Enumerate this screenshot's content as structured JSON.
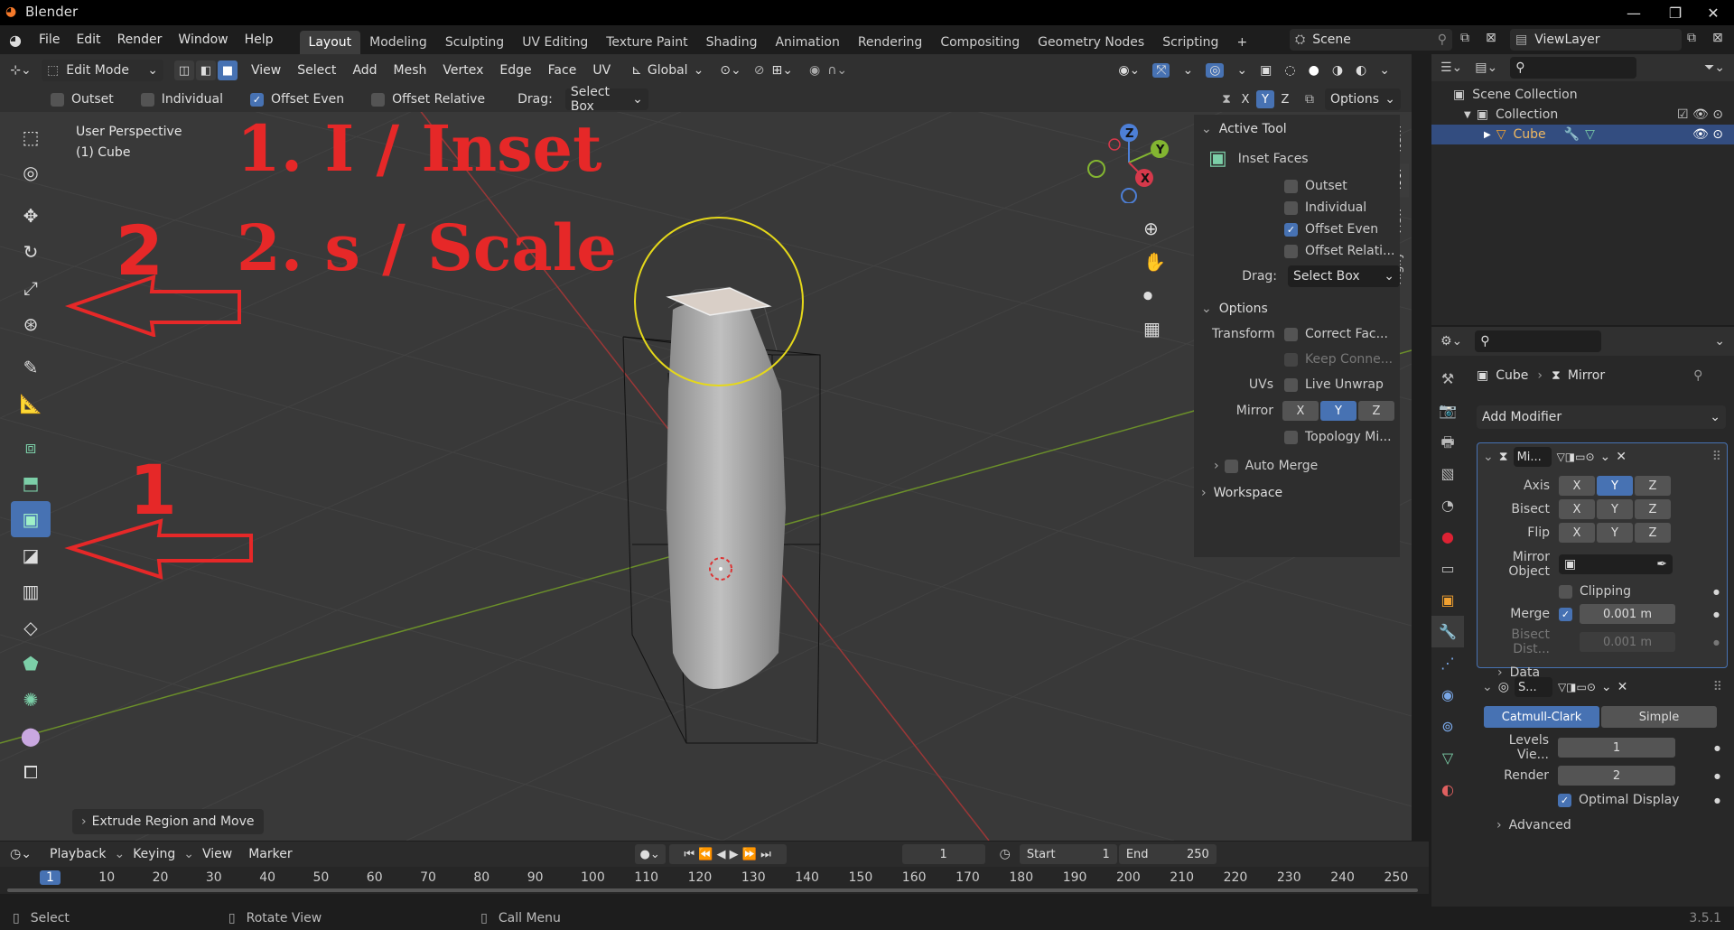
{
  "titlebar": {
    "title": "Blender",
    "min": "—",
    "max": "❐",
    "close": "✕"
  },
  "menubar": {
    "menus": [
      "File",
      "Edit",
      "Render",
      "Window",
      "Help"
    ],
    "tabs": [
      "Layout",
      "Modeling",
      "Sculpting",
      "UV Editing",
      "Texture Paint",
      "Shading",
      "Animation",
      "Rendering",
      "Compositing",
      "Geometry Nodes",
      "Scripting"
    ],
    "add_tab": "+",
    "scene": "Scene",
    "view_layer": "ViewLayer"
  },
  "viewport_header": {
    "mode": "Edit Mode",
    "menus": [
      "View",
      "Select",
      "Add",
      "Mesh",
      "Vertex",
      "Edge",
      "Face",
      "UV"
    ],
    "orientation": "Global",
    "axes": [
      "X",
      "Y",
      "Z"
    ],
    "options": "Options"
  },
  "tool_settings": {
    "outset": "Outset",
    "individual": "Individual",
    "offset_even": "Offset Even",
    "offset_relative": "Offset Relative",
    "drag_label": "Drag:",
    "drag_value": "Select Box"
  },
  "viewport": {
    "perspective": "User Perspective",
    "object": "(1) Cube",
    "annotation_line1": "1. I / Inset",
    "annotation_line2": "2. s / Scale",
    "annotation_num2": "2",
    "annotation_num1": "1",
    "last_op": "Extrude Region and Move",
    "gizmo": {
      "x": "X",
      "y": "Y",
      "z": "Z"
    }
  },
  "npanel": {
    "tabs": [
      "Item",
      "Tool",
      "View",
      "Rigify"
    ],
    "active_tool_title": "Active Tool",
    "tool_name": "Inset Faces",
    "outset": "Outset",
    "individual": "Individual",
    "offset_even": "Offset Even",
    "offset_relative": "Offset Relati...",
    "drag_label": "Drag:",
    "drag_value": "Select Box",
    "options_title": "Options",
    "transform_label": "Transform",
    "correct_face": "Correct Fac...",
    "keep_connected": "Keep Conne...",
    "uvs_label": "UVs",
    "live_unwrap": "Live Unwrap",
    "mirror_label": "Mirror",
    "topology_mirror": "Topology Mi...",
    "auto_merge": "Auto Merge",
    "workspace": "Workspace"
  },
  "outliner": {
    "scene_collection": "Scene Collection",
    "collection": "Collection",
    "cube": "Cube"
  },
  "properties": {
    "breadcrumb_object": "Cube",
    "breadcrumb_modifier": "Mirror",
    "add_modifier": "Add Modifier",
    "mirror": {
      "name": "Mi...",
      "axis_label": "Axis",
      "bisect_label": "Bisect",
      "flip_label": "Flip",
      "mirror_object": "Mirror Object",
      "clipping": "Clipping",
      "merge_label": "Merge",
      "merge_value": "0.001 m",
      "bisect_dist_label": "Bisect Dist...",
      "bisect_dist_value": "0.001 m",
      "data": "Data"
    },
    "subsurf": {
      "name": "S...",
      "catmull": "Catmull-Clark",
      "simple": "Simple",
      "levels_label": "Levels Vie...",
      "levels_value": "1",
      "render_label": "Render",
      "render_value": "2",
      "optimal": "Optimal Display",
      "advanced": "Advanced"
    }
  },
  "timeline": {
    "menus": [
      "Playback",
      "Keying",
      "View",
      "Marker"
    ],
    "current_frame": "1",
    "start_label": "Start",
    "start_value": "1",
    "end_label": "End",
    "end_value": "250",
    "ticks": [
      "1",
      "10",
      "20",
      "30",
      "40",
      "50",
      "60",
      "70",
      "80",
      "90",
      "100",
      "110",
      "120",
      "130",
      "140",
      "150",
      "160",
      "170",
      "180",
      "190",
      "200",
      "210",
      "220",
      "230",
      "240",
      "250"
    ]
  },
  "status": {
    "select": "Select",
    "rotate": "Rotate View",
    "call_menu": "Call Menu",
    "version": "3.5.1"
  }
}
